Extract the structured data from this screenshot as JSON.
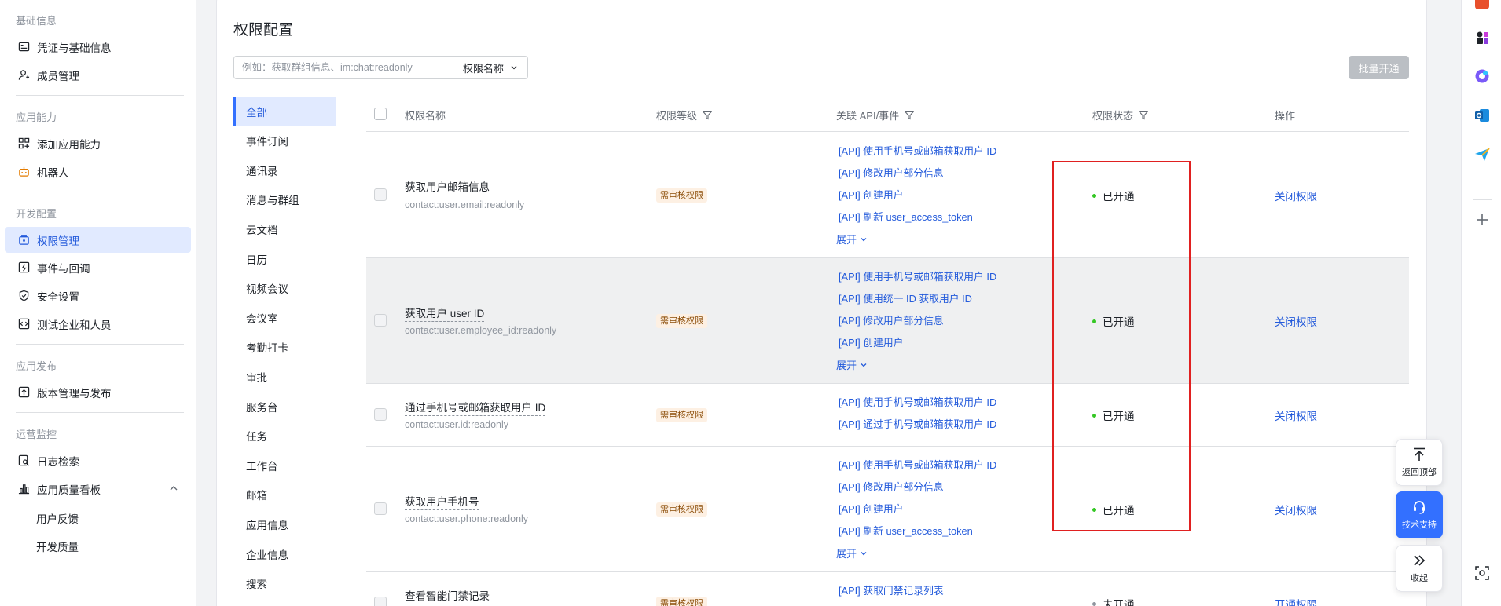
{
  "sidebar": {
    "groups": [
      "基础信息",
      "应用能力",
      "开发配置",
      "应用发布",
      "运营监控"
    ],
    "items": [
      {
        "label": "凭证与基础信息",
        "icon": "credential-icon"
      },
      {
        "label": "成员管理",
        "icon": "member-icon"
      },
      {
        "label": "添加应用能力",
        "icon": "apps-icon"
      },
      {
        "label": "机器人",
        "icon": "robot-icon"
      },
      {
        "label": "权限管理",
        "icon": "permission-icon"
      },
      {
        "label": "事件与回调",
        "icon": "event-icon"
      },
      {
        "label": "安全设置",
        "icon": "shield-icon"
      },
      {
        "label": "测试企业和人员",
        "icon": "test-icon"
      },
      {
        "label": "版本管理与发布",
        "icon": "upload-icon"
      },
      {
        "label": "日志检索",
        "icon": "log-search-icon"
      },
      {
        "label": "应用质量看板",
        "icon": "chart-icon"
      }
    ],
    "subitems": [
      "用户反馈",
      "开发质量"
    ]
  },
  "main": {
    "title": "权限配置",
    "search_placeholder": "例如：获取群组信息、im:chat:readonly",
    "search_field": "权限名称",
    "batch_button": "批量开通"
  },
  "categories": [
    "全部",
    "事件订阅",
    "通讯录",
    "消息与群组",
    "云文档",
    "日历",
    "视频会议",
    "会议室",
    "考勤打卡",
    "审批",
    "服务台",
    "任务",
    "工作台",
    "邮箱",
    "应用信息",
    "企业信息",
    "搜索"
  ],
  "table": {
    "headers": {
      "name": "权限名称",
      "level": "权限等级",
      "api": "关联 API/事件",
      "status": "权限状态",
      "action": "操作"
    },
    "expand_label": "展开",
    "rows": [
      {
        "name": "获取用户邮箱信息",
        "code": "contact:user.email:readonly",
        "level": "需审核权限",
        "apis": [
          "[API] 使用手机号或邮箱获取用户 ID",
          "[API] 修改用户部分信息",
          "[API] 创建用户",
          "[API] 刷新 user_access_token"
        ],
        "status": "已开通",
        "action": "关闭权限"
      },
      {
        "name": "获取用户 user ID",
        "code": "contact:user.employee_id:readonly",
        "level": "需审核权限",
        "apis": [
          "[API] 使用手机号或邮箱获取用户 ID",
          "[API] 使用统一 ID 获取用户 ID",
          "[API] 修改用户部分信息",
          "[API] 创建用户"
        ],
        "status": "已开通",
        "action": "关闭权限"
      },
      {
        "name": "通过手机号或邮箱获取用户 ID",
        "code": "contact:user.id:readonly",
        "level": "需审核权限",
        "apis": [
          "[API] 使用手机号或邮箱获取用户 ID",
          "[API] 通过手机号或邮箱获取用户 ID"
        ],
        "status": "已开通",
        "action": "关闭权限"
      },
      {
        "name": "获取用户手机号",
        "code": "contact:user.phone:readonly",
        "level": "需审核权限",
        "apis": [
          "[API] 使用手机号或邮箱获取用户 ID",
          "[API] 修改用户部分信息",
          "[API] 创建用户",
          "[API] 刷新 user_access_token"
        ],
        "status": "已开通",
        "action": "关闭权限"
      },
      {
        "name": "查看智能门禁记录",
        "code": "",
        "level": "需审核权限",
        "apis": [
          "[API] 获取门禁记录列表"
        ],
        "status": "未开通",
        "action": "开通权限"
      }
    ]
  },
  "float_tools": {
    "back_top": "返回顶部",
    "support": "技术支持",
    "collapse": "收起"
  },
  "colors": {
    "accent": "#3370ff",
    "link": "#245bdb",
    "active_bg": "#e1eaff",
    "status_on": "#34c724",
    "badge_bg": "#fdf0e3",
    "highlight_border": "#e02020"
  }
}
